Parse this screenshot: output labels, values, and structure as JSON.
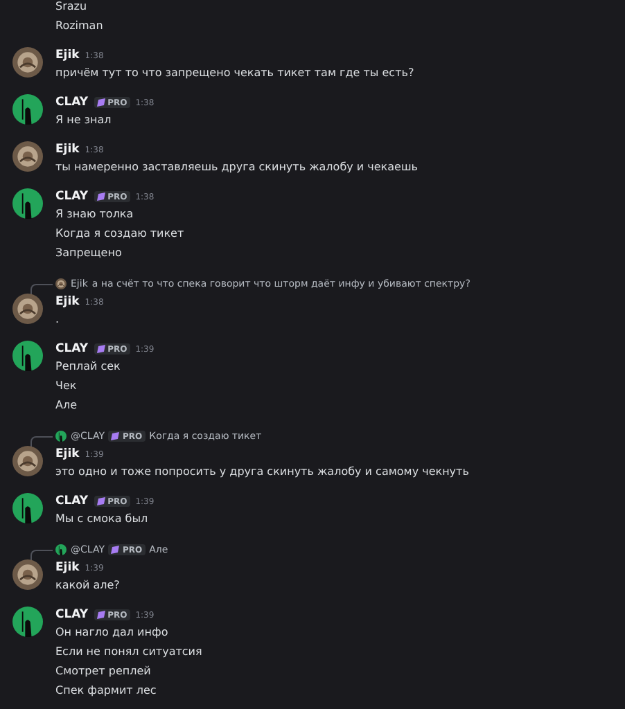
{
  "messages": [
    {
      "lines": [
        "Srazu",
        "Roziman"
      ]
    },
    {
      "author": {
        "name": "Ejik",
        "kind": "ejik",
        "pro": false
      },
      "time": "1:38",
      "lines": [
        "причём тут то что запрещено чекать тикет там где ты есть?"
      ]
    },
    {
      "author": {
        "name": "CLAY",
        "kind": "clay",
        "pro": true,
        "badge": "PRO"
      },
      "time": "1:38",
      "lines": [
        "Я не знал"
      ]
    },
    {
      "author": {
        "name": "Ejik",
        "kind": "ejik",
        "pro": false
      },
      "time": "1:38",
      "lines": [
        "ты намеренно заставляешь друга скинуть жалобу и чекаешь"
      ]
    },
    {
      "author": {
        "name": "CLAY",
        "kind": "clay",
        "pro": true,
        "badge": "PRO"
      },
      "time": "1:38",
      "lines": [
        "Я знаю толка",
        "Когда я  создаю тикет",
        "Запрещено"
      ]
    },
    {
      "reply": {
        "name": "Ejik",
        "kind": "ejik",
        "pro": false,
        "text": "а на счёт то что спека говорит что шторм даёт инфу и убивают спектру?"
      },
      "author": {
        "name": "Ejik",
        "kind": "ejik",
        "pro": false
      },
      "time": "1:38",
      "lines": [
        "."
      ]
    },
    {
      "author": {
        "name": "CLAY",
        "kind": "clay",
        "pro": true,
        "badge": "PRO"
      },
      "time": "1:39",
      "lines": [
        "Реплай сек",
        "Чек",
        "Але"
      ]
    },
    {
      "reply": {
        "name": "@CLAY",
        "kind": "clay",
        "pro": true,
        "badge": "PRO",
        "text": "Когда я  создаю тикет"
      },
      "author": {
        "name": "Ejik",
        "kind": "ejik",
        "pro": false
      },
      "time": "1:39",
      "lines": [
        "это одно и тоже попросить у друга скинуть жалобу и самому чекнуть"
      ]
    },
    {
      "author": {
        "name": "CLAY",
        "kind": "clay",
        "pro": true,
        "badge": "PRO"
      },
      "time": "1:39",
      "lines": [
        "Мы с смока был"
      ]
    },
    {
      "reply": {
        "name": "@CLAY",
        "kind": "clay",
        "pro": true,
        "badge": "PRO",
        "text": "Але"
      },
      "author": {
        "name": "Ejik",
        "kind": "ejik",
        "pro": false
      },
      "time": "1:39",
      "lines": [
        "какой але?"
      ]
    },
    {
      "author": {
        "name": "CLAY",
        "kind": "clay",
        "pro": true,
        "badge": "PRO"
      },
      "time": "1:39",
      "lines": [
        "Он нагло дал инфо",
        "Если не понял ситуатсия",
        "Смотрет реплей",
        "Спек фармит лес"
      ]
    }
  ]
}
